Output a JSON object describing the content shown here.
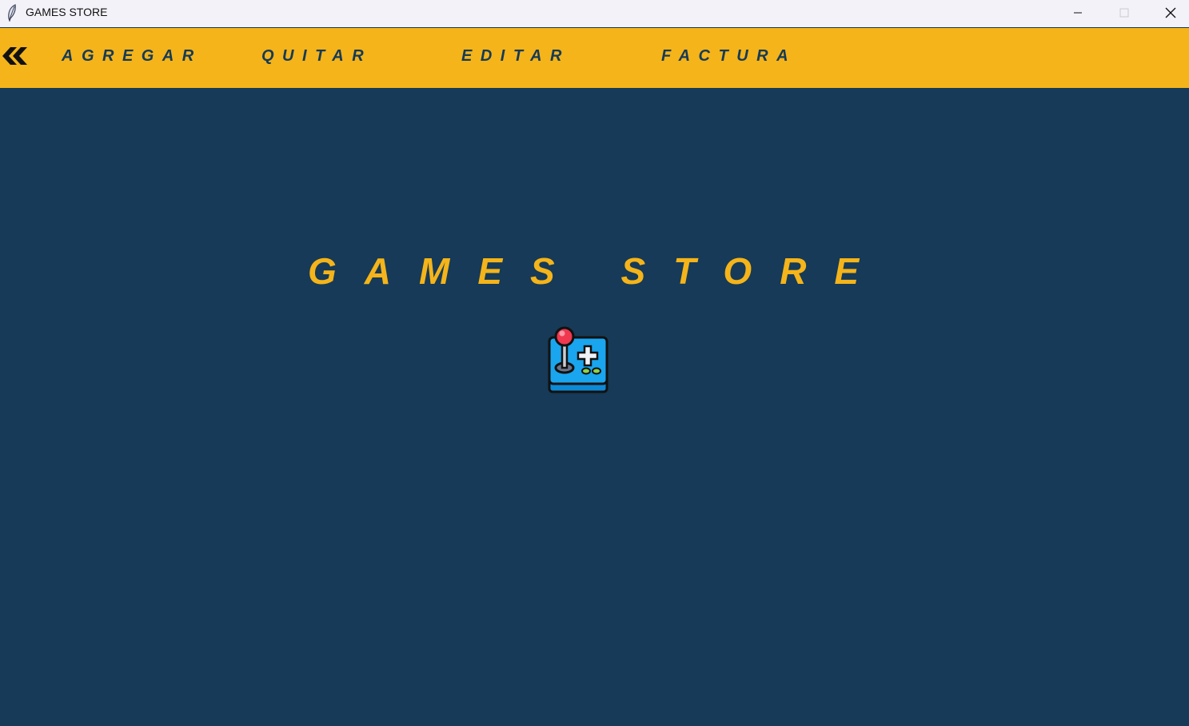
{
  "window": {
    "title": "GAMES STORE"
  },
  "navbar": {
    "back_icon": "double-chevron-left-icon",
    "items": [
      {
        "label": "AGREGAR"
      },
      {
        "label": "QUITAR"
      },
      {
        "label": "EDITAR"
      },
      {
        "label": "FACTURA"
      }
    ]
  },
  "main": {
    "title": "GAMES STORE",
    "logo_icon": "arcade-joystick-icon"
  },
  "colors": {
    "background": "#163a57",
    "accent": "#f4b41a",
    "titlebar": "#f3f2f8"
  }
}
